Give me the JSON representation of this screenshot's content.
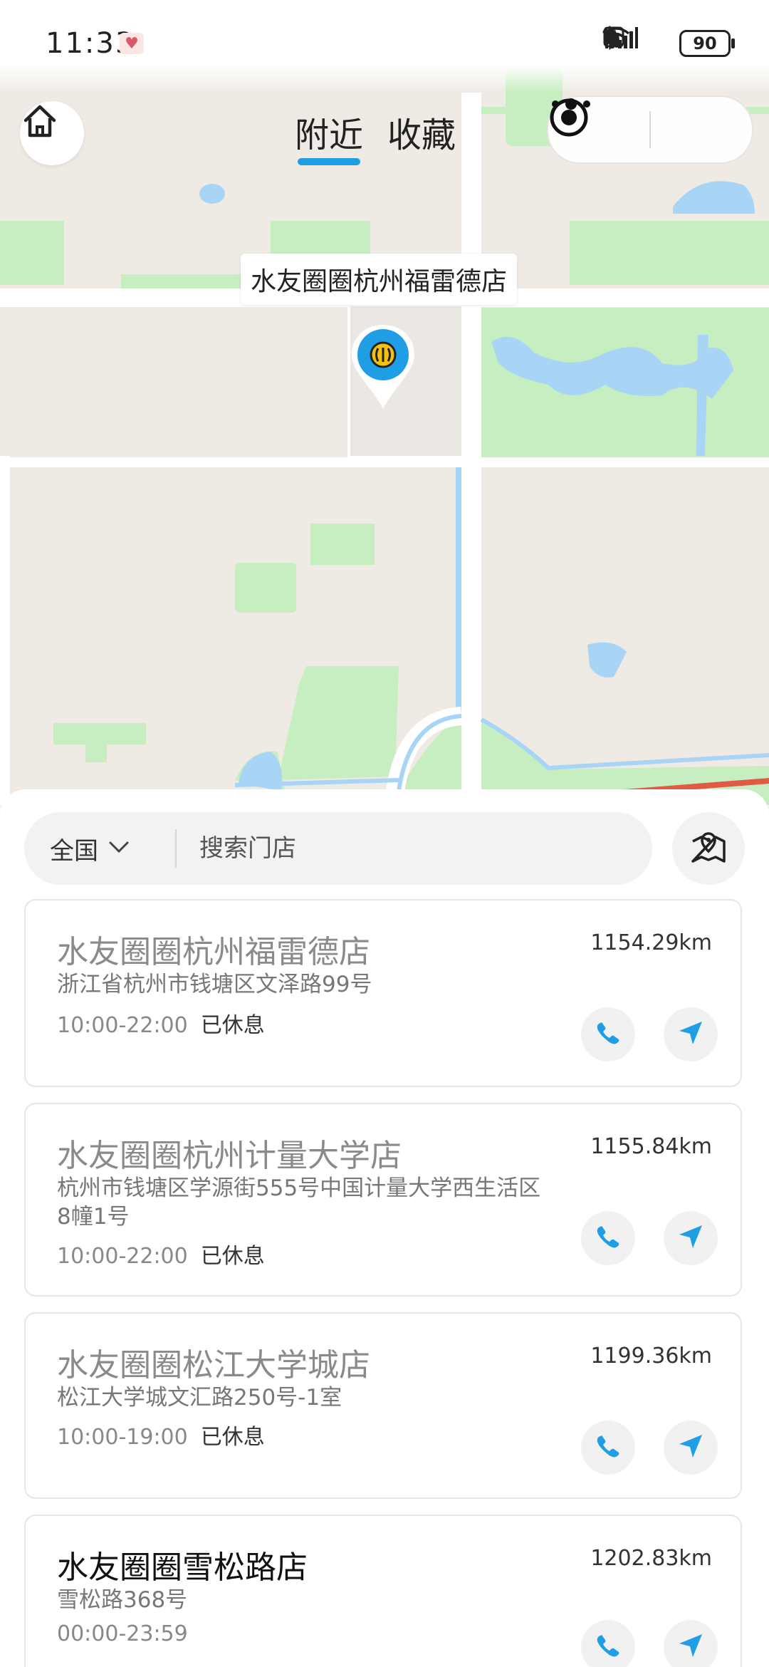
{
  "status_bar": {
    "time": "11:33",
    "heart_icon": "heart-icon",
    "icons": [
      "nfc-icon",
      "bluetooth-icon",
      "moon-icon",
      "mute-icon",
      "wifi-icon",
      "4g-icon",
      "signal-icon"
    ],
    "battery": "90"
  },
  "header": {
    "tabs": [
      {
        "label": "附近",
        "active": true
      },
      {
        "label": "收藏",
        "active": false
      }
    ]
  },
  "map": {
    "marker_label": "水友圈圈杭州福雷德店",
    "marker_color": "#1f9ee6",
    "water_color": "#a8d4f5",
    "park_color": "#c6eec0",
    "land_color": "#efebe4"
  },
  "search": {
    "region": "全国",
    "placeholder": "搜索门店"
  },
  "stores": [
    {
      "name": "水友圈圈杭州福雷德店",
      "distance": "1154.29km",
      "address": "浙江省杭州市钱塘区文泽路99号",
      "hours": "10:00-22:00",
      "status": "已休息",
      "closed": true
    },
    {
      "name": "水友圈圈杭州计量大学店",
      "distance": "1155.84km",
      "address": "杭州市钱塘区学源街555号中国计量大学西生活区8幢1号",
      "hours": "10:00-22:00",
      "status": "已休息",
      "closed": true
    },
    {
      "name": "水友圈圈松江大学城店",
      "distance": "1199.36km",
      "address": "松江大学城文汇路250号-1室",
      "hours": "10:00-19:00",
      "status": "已休息",
      "closed": true
    },
    {
      "name": "水友圈圈雪松路店",
      "distance": "1202.83km",
      "address": "雪松路368号",
      "hours": "00:00-23:59",
      "status": "",
      "closed": false
    }
  ],
  "accent_color": "#1f9ee6"
}
